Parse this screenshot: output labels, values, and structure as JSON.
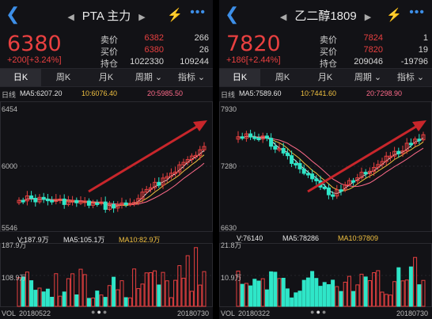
{
  "left": {
    "title": "PTA 主力",
    "price": "6380",
    "change": "+200[+3.24%]",
    "quote": [
      {
        "label": "卖价",
        "v1": "6382",
        "v2": "266"
      },
      {
        "label": "买价",
        "v1": "6380",
        "v2": "26"
      },
      {
        "label": "持仓",
        "v1": "1022330",
        "v2": "109244"
      }
    ],
    "tabs": [
      "日K",
      "周K",
      "月K",
      "周期",
      "指标"
    ],
    "mode": "日线",
    "ma": {
      "ma5": "MA5:6207.20",
      "ma10": "10:6076.40",
      "ma20": "20:5985.50"
    },
    "axis": {
      "top": "6454",
      "mid": "6000",
      "low": "5546"
    },
    "vol_ma": {
      "v": "V:187.9万",
      "ma5": "MA5:105.1万",
      "ma10": "MA10:82.9万"
    },
    "vol_axis": {
      "top": "187.9万",
      "mid": "108.9万"
    },
    "footer": {
      "vol": "VOL",
      "start": "20180522",
      "end": "20180730"
    }
  },
  "right": {
    "title": "乙二醇1809",
    "price": "7820",
    "change": "+186[+2.44%]",
    "quote": [
      {
        "label": "卖价",
        "v1": "7824",
        "v2": "1"
      },
      {
        "label": "买价",
        "v1": "7820",
        "v2": "19"
      },
      {
        "label": "持仓",
        "v1": "209046",
        "v2": "-19796"
      }
    ],
    "tabs": [
      "日K",
      "周K",
      "月K",
      "周期",
      "指标"
    ],
    "mode": "日线",
    "ma": {
      "ma5": "MA5:7589.60",
      "ma10": "10:7441.60",
      "ma20": "20:7298.90"
    },
    "axis": {
      "top": "7930",
      "mid": "7280",
      "low": "6630"
    },
    "vol_ma": {
      "v": "V:76140",
      "ma5": "MA5:78286",
      "ma10": "MA10:97809"
    },
    "vol_axis": {
      "top": "21.8万",
      "mid": "10.9万"
    },
    "footer": {
      "vol": "VOL",
      "start": "20180322",
      "end": "20180730"
    }
  },
  "colors": {
    "up": "#e84040",
    "down": "#2fe6c8",
    "accent": "#3d8fe8",
    "ma10": "#f0c040",
    "ma20": "#ff6b8a"
  }
}
